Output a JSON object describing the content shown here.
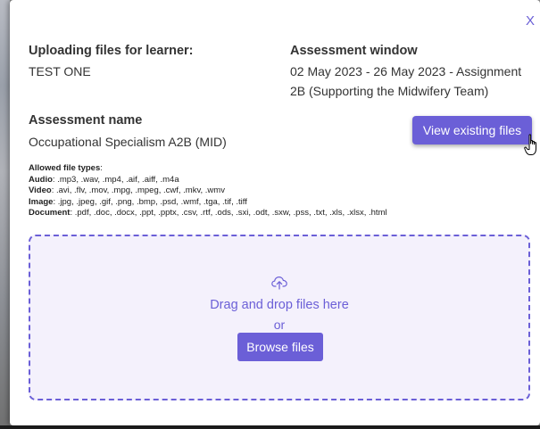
{
  "modal": {
    "close_label": "X",
    "learner": {
      "label": "Uploading files for learner:",
      "value": "TEST ONE"
    },
    "assessment_window": {
      "label": "Assessment window",
      "line1": "02 May 2023 - 26 May 2023 - Assignment",
      "line2": "2B (Supporting the Midwifery Team)"
    },
    "assessment_name": {
      "label": "Assessment name",
      "value": "Occupational Specialism A2B (MID)"
    },
    "view_files_label": "View existing files",
    "allowed": {
      "heading": "Allowed file types",
      "audio_label": "Audio",
      "audio": ".mp3, .wav, .mp4, .aif, .aiff, .m4a",
      "video_label": "Video",
      "video": ".avi, .flv, .mov, .mpg, .mpeg, .cwf, .mkv, .wmv",
      "image_label": "Image",
      "image": ".jpg, .jpeg, .gif, .png, .bmp, .psd, .wmf, .tga, .tif, .tiff",
      "document_label": "Document",
      "document": ".pdf, .doc, .docx, .ppt, .pptx, .csv, .rtf, .ods, .sxi, .odt, .sxw, .pss, .txt, .xls, .xlsx, .html"
    },
    "dropzone": {
      "icon": "cloud-upload-icon",
      "drag_text": "Drag and drop files here",
      "or_text": "or",
      "browse_label": "Browse files"
    }
  },
  "colors": {
    "accent": "#6b5fd7",
    "dropzone_bg": "#f4f1fc",
    "text": "#333333"
  }
}
